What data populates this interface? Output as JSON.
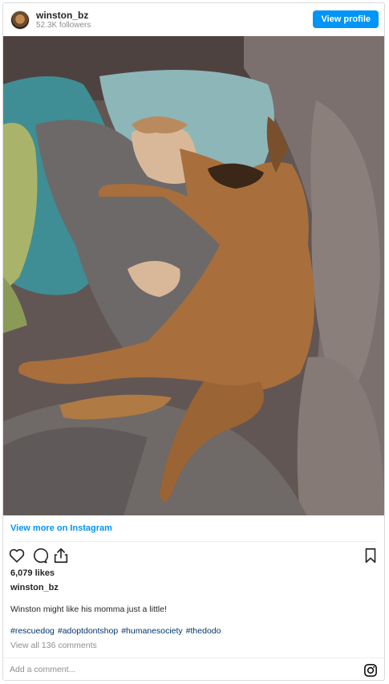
{
  "header": {
    "username": "winston_bz",
    "followers": "52.3K followers",
    "view_profile": "View profile"
  },
  "post": {
    "view_more": "View more on Instagram",
    "likes": "6,079 likes",
    "owner": "winston_bz",
    "caption": "Winston might like his momma just a little!",
    "hashtags": [
      "#rescuedog",
      "#adoptdontshop",
      "#humanesociety",
      "#thedodo"
    ],
    "comments_link": "View all 136 comments"
  },
  "comment_box": {
    "placeholder": "Add a comment..."
  },
  "icons": {
    "like": "heart-icon",
    "comment": "comment-icon",
    "share": "share-icon",
    "save": "bookmark-icon",
    "brand": "instagram-icon"
  },
  "colors": {
    "accent": "#0095f6",
    "hashtag": "#00376b",
    "muted": "#8e8e8e"
  }
}
